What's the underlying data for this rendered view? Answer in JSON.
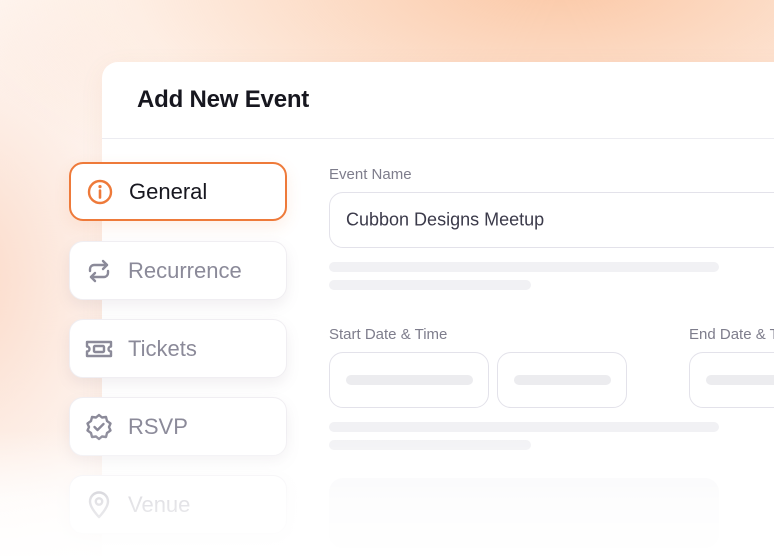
{
  "dialog": {
    "title": "Add New Event"
  },
  "sidebar": {
    "items": [
      {
        "label": "General",
        "icon": "info-icon",
        "active": true
      },
      {
        "label": "Recurrence",
        "icon": "repeat-icon",
        "active": false
      },
      {
        "label": "Tickets",
        "icon": "ticket-icon",
        "active": false
      },
      {
        "label": "RSVP",
        "icon": "badge-check-icon",
        "active": false
      },
      {
        "label": "Venue",
        "icon": "map-pin-icon",
        "active": false
      }
    ]
  },
  "form": {
    "event_name_label": "Event Name",
    "event_name_value": "Cubbon Designs Meetup",
    "start_label": "Start Date & Time",
    "end_label": "End Date & T"
  },
  "colors": {
    "accent": "#ee7a3a",
    "muted_text": "#8b8a99",
    "title_text": "#17171f"
  }
}
